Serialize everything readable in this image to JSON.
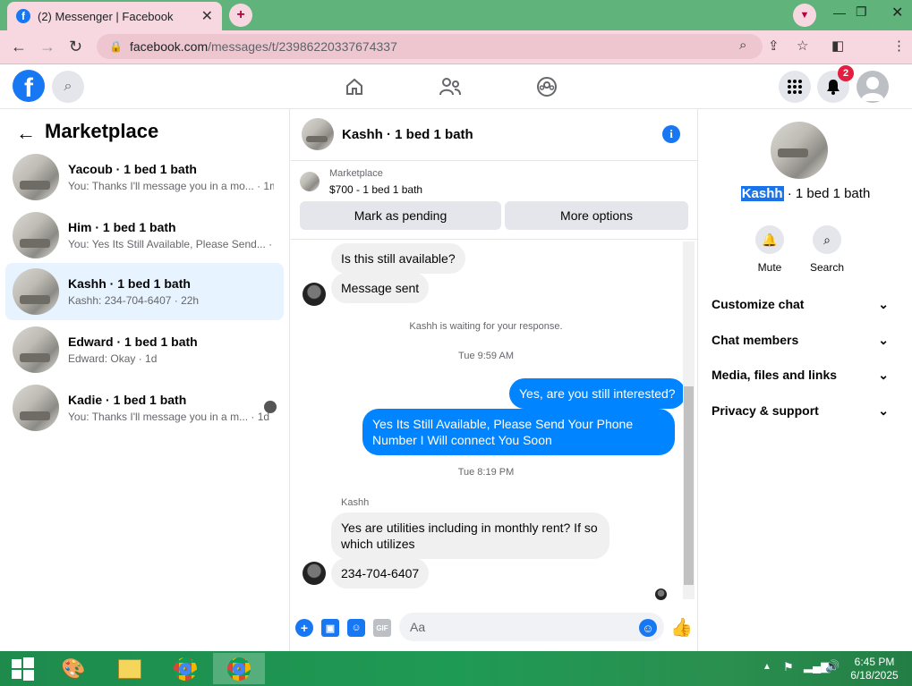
{
  "browser": {
    "tab_title": "(2) Messenger | Facebook",
    "url_main": "facebook.com",
    "url_rest": "/messages/t/23986220337674337"
  },
  "header": {
    "notification_count": "2"
  },
  "left": {
    "title": "Marketplace",
    "conversations": [
      {
        "name": "Yacoub · 1 bed 1 bath",
        "preview": "You: Thanks I'll message you in a mo... · 1m"
      },
      {
        "name": "Him · 1 bed 1 bath",
        "preview": "You: Yes Its Still Available, Please Send... · 1h"
      },
      {
        "name": "Kashh · 1 bed 1 bath",
        "preview": "Kashh: 234-704-6407 · 22h"
      },
      {
        "name": "Edward · 1 bed 1 bath",
        "preview": "Edward: Okay · 1d"
      },
      {
        "name": "Kadie · 1 bed 1 bath",
        "preview": "You: Thanks I'll message you in a m... · 1d"
      }
    ]
  },
  "chat": {
    "title": "Kashh · 1 bed 1 bath",
    "marketplace_label": "Marketplace",
    "listing": "$700 - 1 bed 1 bath",
    "mark_pending": "Mark as pending",
    "more_options": "More options",
    "messages": {
      "m1": "Is this still available?",
      "m2": "Message sent",
      "sys1": "Kashh is waiting for your response.",
      "time1": "Tue 9:59 AM",
      "o1": "Yes, are you still interested?",
      "o2": "Yes Its Still Available, Please Send Your Phone Number I Will connect You Soon",
      "time2": "Tue 8:19 PM",
      "sender": "Kashh",
      "m3": "Yes are utilities including in monthly rent? If so which utilizes",
      "m4": "234-704-6407"
    },
    "composer_placeholder": "Aa"
  },
  "right": {
    "name_highlight": "Kashh",
    "name_rest": " · 1 bed 1 bath",
    "mute": "Mute",
    "search": "Search",
    "sections": [
      "Customize chat",
      "Chat members",
      "Media, files and links",
      "Privacy & support"
    ]
  },
  "taskbar": {
    "time": "6:45 PM",
    "date": "6/18/2025"
  },
  "colors": {
    "accent": "#1877f2",
    "bubble_out": "#0084ff",
    "tabbar": "#5fb37b",
    "addrbar": "#f8d8e0"
  }
}
